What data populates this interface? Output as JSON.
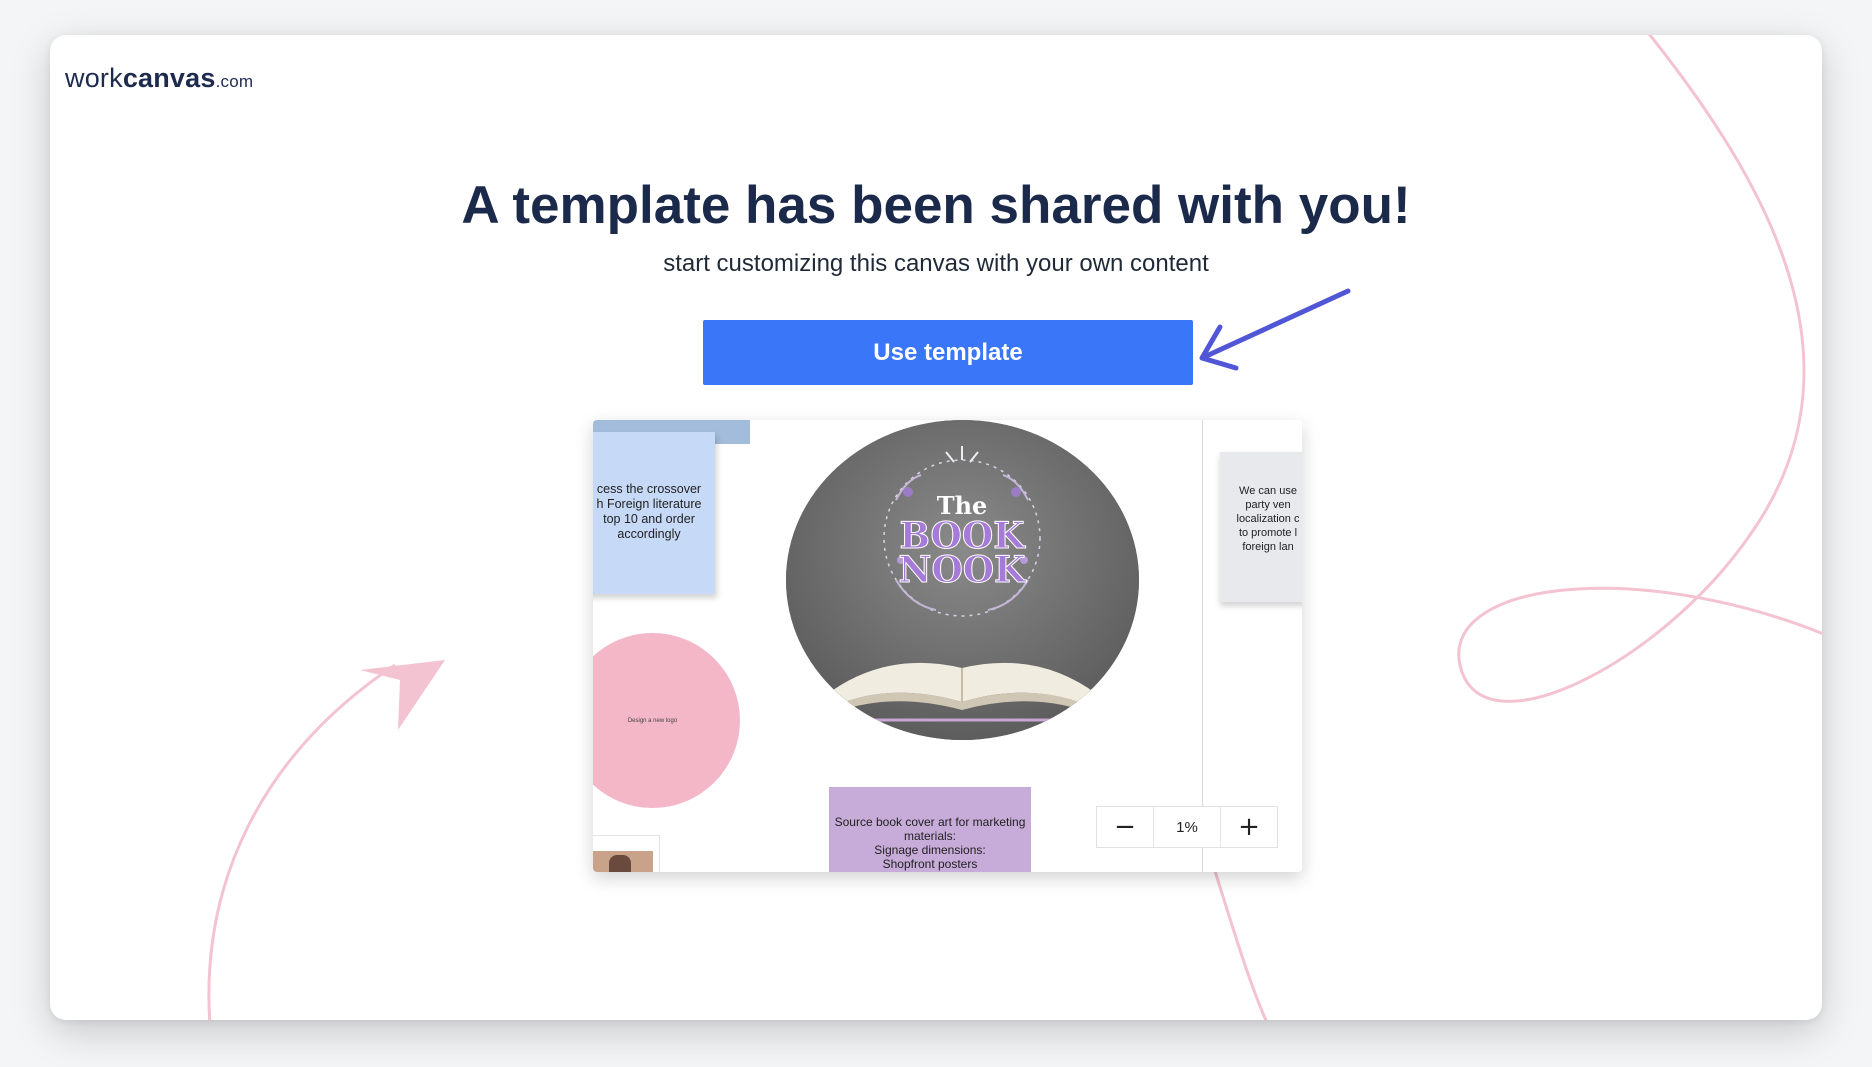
{
  "logo": {
    "part1": "work",
    "part2": "canvas",
    "part3": ".com"
  },
  "headline": "A template has been shared with you!",
  "subheadline": "start customizing this canvas with your own content",
  "cta": {
    "label": "Use template"
  },
  "preview": {
    "sticky_blue": "cess the crossover\nh Foreign literature\ntop 10 and order\naccordingly",
    "book_logo": {
      "line1": "The",
      "line2": "BOOK",
      "line3": "NOOK"
    },
    "sticky_grey": "We can use\nparty ven\nlocalization c\nto promote l\nforeign lan",
    "pink_circle": "Design a new logo",
    "sticky_purple": "Source book cover art for marketing\nmaterials:\nSignage dimensions:\nShopfront posters",
    "zoom": {
      "minus": "−",
      "level": "1%",
      "plus": "+"
    }
  },
  "colors": {
    "accent": "#3a76f8",
    "heading": "#1b2a4a",
    "arrow": "#5156d6",
    "decor_pink": "#f3c3d1"
  },
  "icons": [
    "arrow-pointer-icon",
    "pink-arrow-decoration",
    "zoom-out-icon",
    "zoom-in-icon"
  ]
}
